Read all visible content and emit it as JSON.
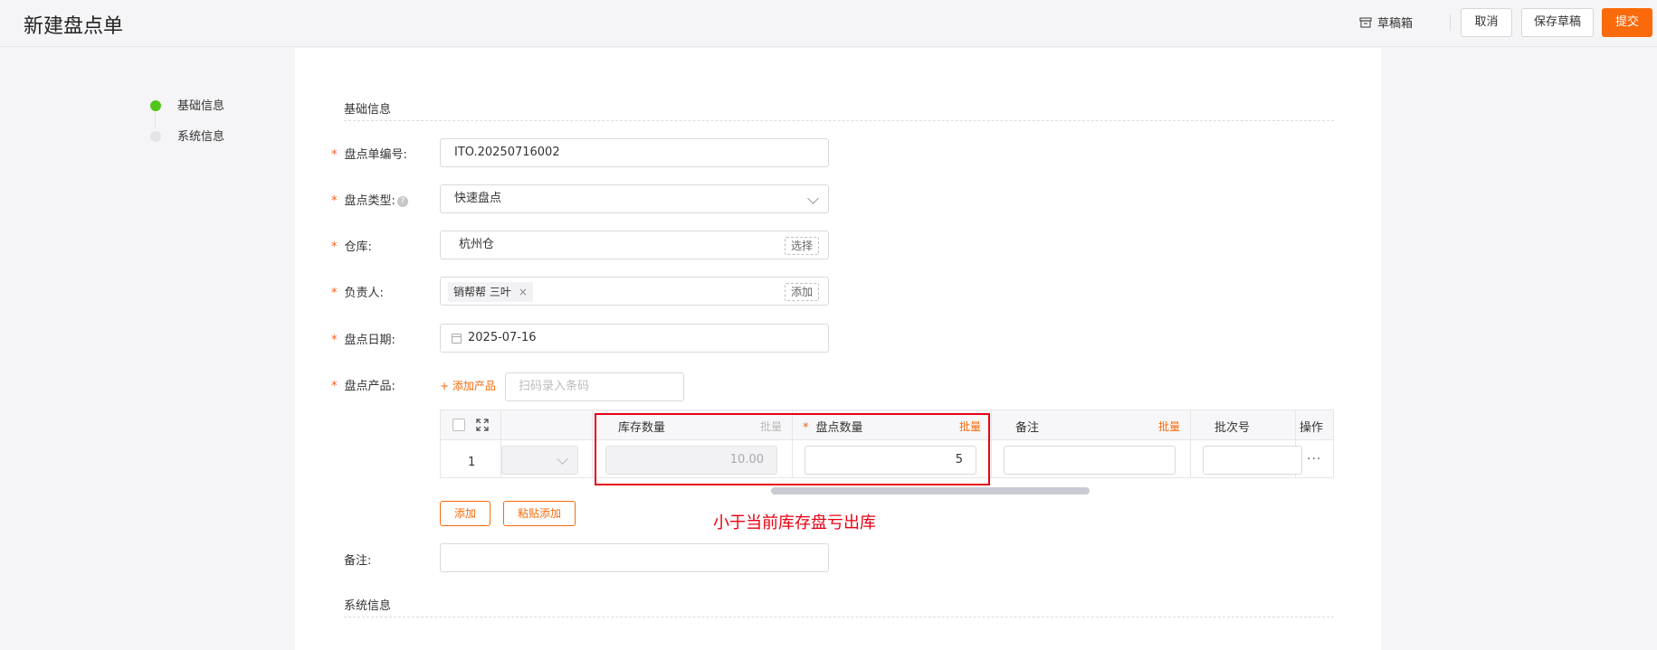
{
  "header": {
    "title": "新建盘点单",
    "drafts_label": "草稿箱",
    "cancel_label": "取消",
    "save_draft_label": "保存草稿",
    "submit_label": "提交"
  },
  "steps": [
    {
      "label": "基础信息",
      "status": "active"
    },
    {
      "label": "系统信息",
      "status": "pending"
    }
  ],
  "form": {
    "section_basic": "基础信息",
    "section_system": "系统信息",
    "fields": {
      "order_no": {
        "label": "盘点单编号:",
        "value": "ITO.20250716002"
      },
      "type": {
        "label": "盘点类型:",
        "value": "快速盘点"
      },
      "warehouse": {
        "label": "仓库:",
        "value": "杭州仓",
        "action": "选择"
      },
      "owner": {
        "label": "负责人:",
        "tag": "销帮帮 三叶",
        "action": "添加"
      },
      "date": {
        "label": "盘点日期:",
        "value": "2025-07-16"
      },
      "products": {
        "label": "盘点产品:",
        "add_label": "+ 添加产品",
        "scan_placeholder": "扫码录入条码"
      },
      "remark": {
        "label": "备注:",
        "value": ""
      }
    }
  },
  "table": {
    "columns": {
      "stock_qty": {
        "label": "库存数量",
        "batch": "批量"
      },
      "count_qty": {
        "label": "盘点数量",
        "batch": "批量"
      },
      "remark": {
        "label": "备注",
        "batch": "批量"
      },
      "batch_no": {
        "label": "批次号"
      },
      "actions": {
        "label": "操作"
      }
    },
    "rows": [
      {
        "index": "1",
        "stock_qty": "10.00",
        "count_qty": "5",
        "remark": "",
        "batch_no": "",
        "more": "···"
      }
    ]
  },
  "buttons": {
    "add_label": "添加",
    "paste_add_label": "粘贴添加"
  },
  "annotation": "小于当前库存盘亏出库",
  "colors": {
    "brand": "#fa6a0a",
    "step_active": "#52c41a",
    "annotation": "#e60012"
  }
}
